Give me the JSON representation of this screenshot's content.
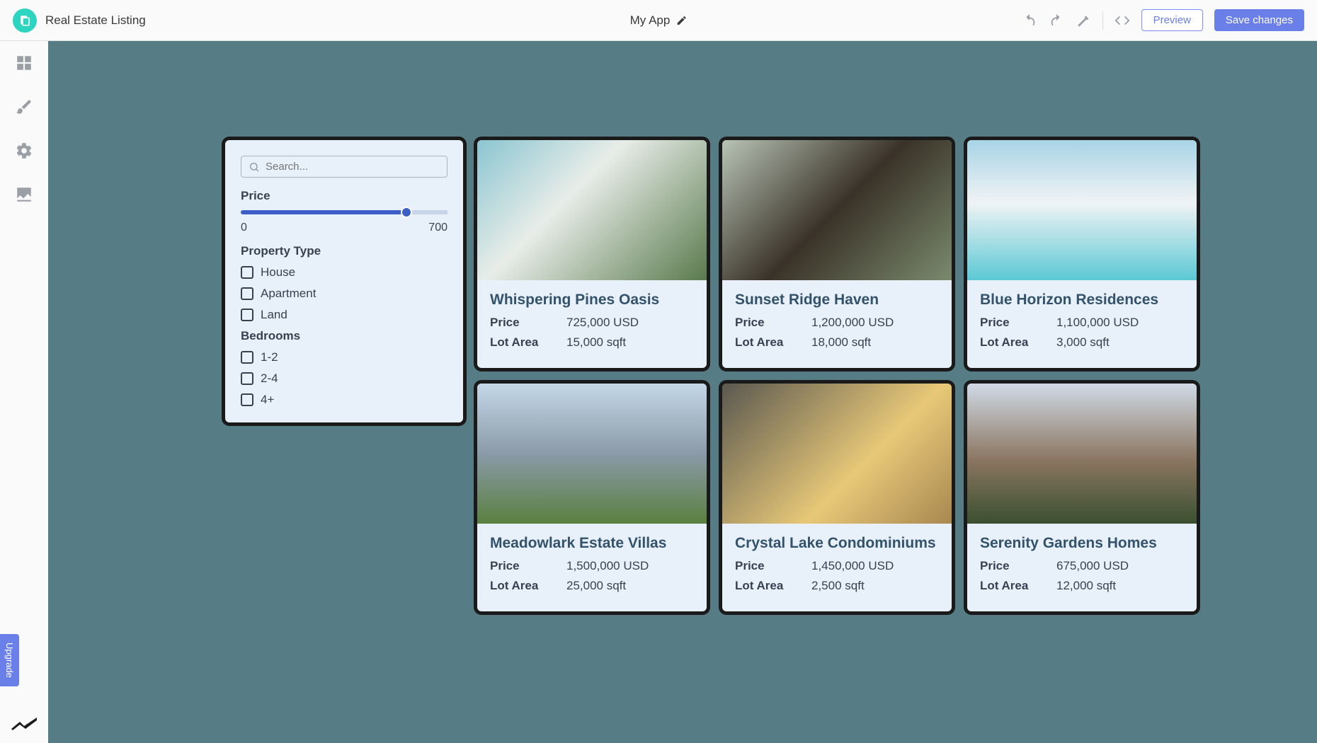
{
  "header": {
    "page_title": "Real Estate Listing",
    "app_name": "My App",
    "preview_label": "Preview",
    "save_label": "Save changes"
  },
  "rail": {
    "upgrade_label": "Upgrade"
  },
  "filters": {
    "search_placeholder": "Search...",
    "price_label": "Price",
    "price_min": "0",
    "price_max": "700",
    "property_type_label": "Property Type",
    "property_types": [
      "House",
      "Apartment",
      "Land"
    ],
    "bedrooms_label": "Bedrooms",
    "bedrooms": [
      "1-2",
      "2-4",
      "4+"
    ]
  },
  "listing_labels": {
    "price": "Price",
    "lot_area": "Lot Area"
  },
  "listings": [
    {
      "title": "Whispering Pines Oasis",
      "price": "725,000 USD",
      "lot": "15,000 sqft"
    },
    {
      "title": "Sunset Ridge Haven",
      "price": "1,200,000 USD",
      "lot": "18,000 sqft"
    },
    {
      "title": "Blue Horizon Residences",
      "price": "1,100,000 USD",
      "lot": "3,000 sqft"
    },
    {
      "title": "Meadowlark Estate Villas",
      "price": "1,500,000 USD",
      "lot": "25,000 sqft"
    },
    {
      "title": "Crystal Lake Condominiums",
      "price": "1,450,000 USD",
      "lot": "2,500 sqft"
    },
    {
      "title": "Serenity Gardens Homes",
      "price": "675,000 USD",
      "lot": "12,000 sqft"
    }
  ]
}
